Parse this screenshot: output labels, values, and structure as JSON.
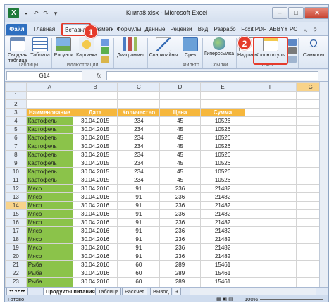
{
  "window": {
    "title": "Книга8.xlsx - Microsoft Excel"
  },
  "app_icon": "excel-icon",
  "tabs": [
    "Файл",
    "Главная",
    "Вставка",
    "Разметк",
    "Формулы",
    "Данные",
    "Рецензи",
    "Вид",
    "Разрабо",
    "Foxit PDF",
    "ABBYY PC"
  ],
  "ribbon": {
    "buttons": {
      "pivot": "Сводная таблица",
      "table": "Таблица",
      "picture": "Рисунок",
      "clipart": "Картинка",
      "charts": "Диаграммы",
      "sparklines": "Спарклайны",
      "slicer": "Срез",
      "hyperlink": "Гиперссылка",
      "textbox": "Надпись",
      "headers": "Колонтитулы",
      "symbols": "Символы"
    },
    "groups": {
      "tables": "Таблицы",
      "illustrations": "Иллюстрации",
      "filter": "Фильтр",
      "links": "Ссылки",
      "text": "Текст"
    }
  },
  "formula_bar": {
    "cell_ref": "G14",
    "fx": "fx",
    "value": ""
  },
  "columns": [
    "A",
    "B",
    "C",
    "D",
    "E",
    "F",
    "G"
  ],
  "rows": [
    {
      "n": "1",
      "cells": []
    },
    {
      "n": "2",
      "cells": []
    },
    {
      "n": "3",
      "header": true,
      "cells": [
        "Наименование",
        "Дата",
        "Количество",
        "Цена",
        "Сумма"
      ]
    },
    {
      "n": "4",
      "cells": [
        "Картофель",
        "30.04.2015",
        "234",
        "45",
        "10526"
      ]
    },
    {
      "n": "5",
      "cells": [
        "Картофель",
        "30.04.2015",
        "234",
        "45",
        "10526"
      ]
    },
    {
      "n": "6",
      "cells": [
        "Картофель",
        "30.04.2015",
        "234",
        "45",
        "10526"
      ]
    },
    {
      "n": "7",
      "cells": [
        "Картофель",
        "30.04.2015",
        "234",
        "45",
        "10526"
      ]
    },
    {
      "n": "8",
      "cells": [
        "Картофель",
        "30.04.2015",
        "234",
        "45",
        "10526"
      ]
    },
    {
      "n": "9",
      "cells": [
        "Картофель",
        "30.04.2015",
        "234",
        "45",
        "10526"
      ]
    },
    {
      "n": "10",
      "cells": [
        "Картофель",
        "30.04.2015",
        "234",
        "45",
        "10526"
      ]
    },
    {
      "n": "11",
      "cells": [
        "Картофель",
        "30.04.2015",
        "234",
        "45",
        "10526"
      ]
    },
    {
      "n": "12",
      "cells": [
        "Мясо",
        "30.04.2016",
        "91",
        "236",
        "21482"
      ]
    },
    {
      "n": "13",
      "cells": [
        "Мясо",
        "30.04.2016",
        "91",
        "236",
        "21482"
      ]
    },
    {
      "n": "14",
      "cells": [
        "Мясо",
        "30.04.2016",
        "91",
        "236",
        "21482"
      ]
    },
    {
      "n": "15",
      "cells": [
        "Мясо",
        "30.04.2016",
        "91",
        "236",
        "21482"
      ]
    },
    {
      "n": "16",
      "cells": [
        "Мясо",
        "30.04.2016",
        "91",
        "236",
        "21482"
      ]
    },
    {
      "n": "17",
      "cells": [
        "Мясо",
        "30.04.2016",
        "91",
        "236",
        "21482"
      ]
    },
    {
      "n": "18",
      "cells": [
        "Мясо",
        "30.04.2016",
        "91",
        "236",
        "21482"
      ]
    },
    {
      "n": "19",
      "cells": [
        "Мясо",
        "30.04.2016",
        "91",
        "236",
        "21482"
      ]
    },
    {
      "n": "20",
      "cells": [
        "Мясо",
        "30.04.2016",
        "91",
        "236",
        "21482"
      ]
    },
    {
      "n": "21",
      "cells": [
        "Рыба",
        "30.04.2016",
        "60",
        "289",
        "15461"
      ]
    },
    {
      "n": "22",
      "cells": [
        "Рыба",
        "30.04.2016",
        "60",
        "289",
        "15461"
      ]
    },
    {
      "n": "23",
      "cells": [
        "Рыба",
        "30.04.2016",
        "60",
        "289",
        "15461"
      ]
    },
    {
      "n": "24",
      "cells": [
        "Рыба",
        "30.04.2016",
        "60",
        "289",
        "15461"
      ]
    }
  ],
  "active_cell": "G14",
  "sheets": [
    "Продукты питания",
    "Таблица",
    "Рассчет",
    "Вывод"
  ],
  "status": {
    "ready": "Готово",
    "zoom": "100%"
  },
  "callouts": [
    "1",
    "2"
  ],
  "colors": {
    "header_fill": "#f6b73c",
    "name_fill": "#8bc34a",
    "callout": "#e53b2c",
    "file_tab": "#2e6fc0"
  }
}
